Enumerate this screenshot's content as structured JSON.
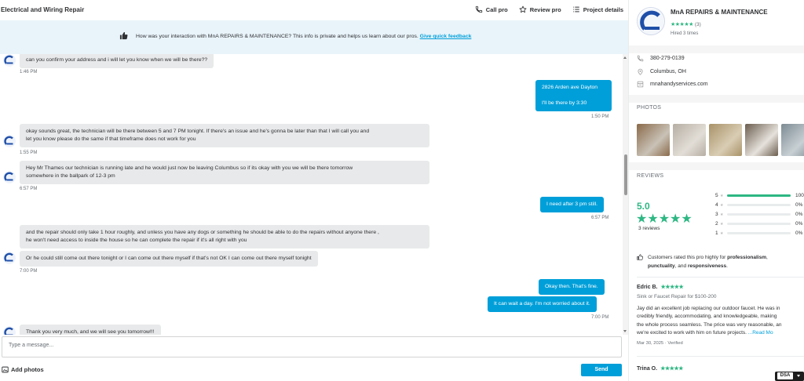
{
  "header": {
    "title": "Electrical and Wiring Repair",
    "actions": [
      {
        "label": "Call pro",
        "icon": "phone-icon"
      },
      {
        "label": "Review pro",
        "icon": "star-icon"
      },
      {
        "label": "Project details",
        "icon": "list-icon"
      }
    ]
  },
  "banner": {
    "text": "How was your interaction with MnA REPAIRS & MAINTENANCE? This info is private and helps us learn about our pros.",
    "link": "Give quick feedback"
  },
  "messages": [
    {
      "text": "can you confirm your address and i will let you know when we will be there??",
      "time": "1:46 PM"
    },
    {
      "lines": [
        "2826 Arden ave Dayton",
        "",
        "I'll be there by 3:30"
      ],
      "time": "1:50 PM"
    },
    {
      "lines": [
        "okay sounds great, the technician will be there between 5 and 7 PM tonight. If there's an issue and he's gonna be later than that I will call you and",
        "let you know please do the same if that timeframe does not work for you"
      ],
      "time": "1:55 PM"
    },
    {
      "lines": [
        "Hey Mr Thames our technician is running late and he would just now be leaving Columbus so if its okay with you we will be there tomorrow",
        "somewhere in the ballpark of 12-3 pm"
      ],
      "time": "6:57 PM"
    },
    {
      "text": "I need after 3 pm still.",
      "time": "6:57 PM"
    },
    {
      "lines": [
        "and the repair should only take 1 hour roughly, and unless you have any dogs or something he should be able to do the repairs without anyone there ,",
        "he won't need access to inside the house so he can complete the repair if it's all right with you"
      ]
    },
    {
      "text": "Or he could still come out there tonight or I can come out there myself if that's not OK I can come out there myself tonight",
      "time": "7:00 PM"
    },
    {
      "text": "Okay then. That's fine."
    },
    {
      "text": "It can wait a day. I'm not worried about it.",
      "time": "7:00 PM"
    },
    {
      "text": "Thank you very much, and we will see you tomorrow!!!"
    }
  ],
  "composer": {
    "placeholder": "Type a message...",
    "add_photos": "Add photos",
    "send": "Send"
  },
  "pro": {
    "name": "MnA REPAIRS & MAINTENANCE",
    "stars": "★★★★★",
    "rating_count": "(3)",
    "hired": "Hired 3 times",
    "phone": "380-279-0139",
    "location": "Columbus, OH",
    "website": "mnahandyservices.com"
  },
  "photos_section": {
    "title": "PHOTOS",
    "photos": [
      {
        "colors": [
          "#8a6a4a",
          "#c9c2b6"
        ]
      },
      {
        "colors": [
          "#b5aea4",
          "#e2ddd6"
        ]
      },
      {
        "colors": [
          "#a89268",
          "#d9cdb4"
        ]
      },
      {
        "colors": [
          "#6b5d4e",
          "#e6e2dc"
        ]
      },
      {
        "colors": [
          "#7d8b93",
          "#c8d0d4"
        ]
      }
    ]
  },
  "reviews_section": {
    "title": "REVIEWS",
    "score": "5.0",
    "stars": "★★★★★",
    "count": "3 reviews",
    "histogram": [
      {
        "stars": "5",
        "pct": "100",
        "fraction": 1.0
      },
      {
        "stars": "4",
        "pct": "0%",
        "fraction": 0
      },
      {
        "stars": "3",
        "pct": "0%",
        "fraction": 0
      },
      {
        "stars": "2",
        "pct": "0%",
        "fraction": 0
      },
      {
        "stars": "1",
        "pct": "0%",
        "fraction": 0
      }
    ],
    "highlight": {
      "prefix": "Customers rated this pro highly for ",
      "b1": "professionalism",
      "sep1": ",",
      "b2": "punctuality",
      "mid": ", and ",
      "b3": "responsiveness",
      "end": "."
    },
    "reviews": [
      {
        "name": "Edric B.",
        "stars": "★★★★★",
        "service": "Sink or Faucet Repair for $100-200",
        "lines": [
          "Jay did an excellent job replacing our outdoor faucet. He was in",
          "credibly friendly, accommodating, and knowledgeable, making",
          "the whole process seamless. The price was very reasonable, an",
          "we're excited to work with him on future projects."
        ],
        "read_more": "...Read Mo",
        "date": "Mar 30, 2025",
        "verified": "Verified"
      },
      {
        "name": "Trina O.",
        "stars": "★★★★★"
      }
    ]
  },
  "dsa_badge": "DSA"
}
